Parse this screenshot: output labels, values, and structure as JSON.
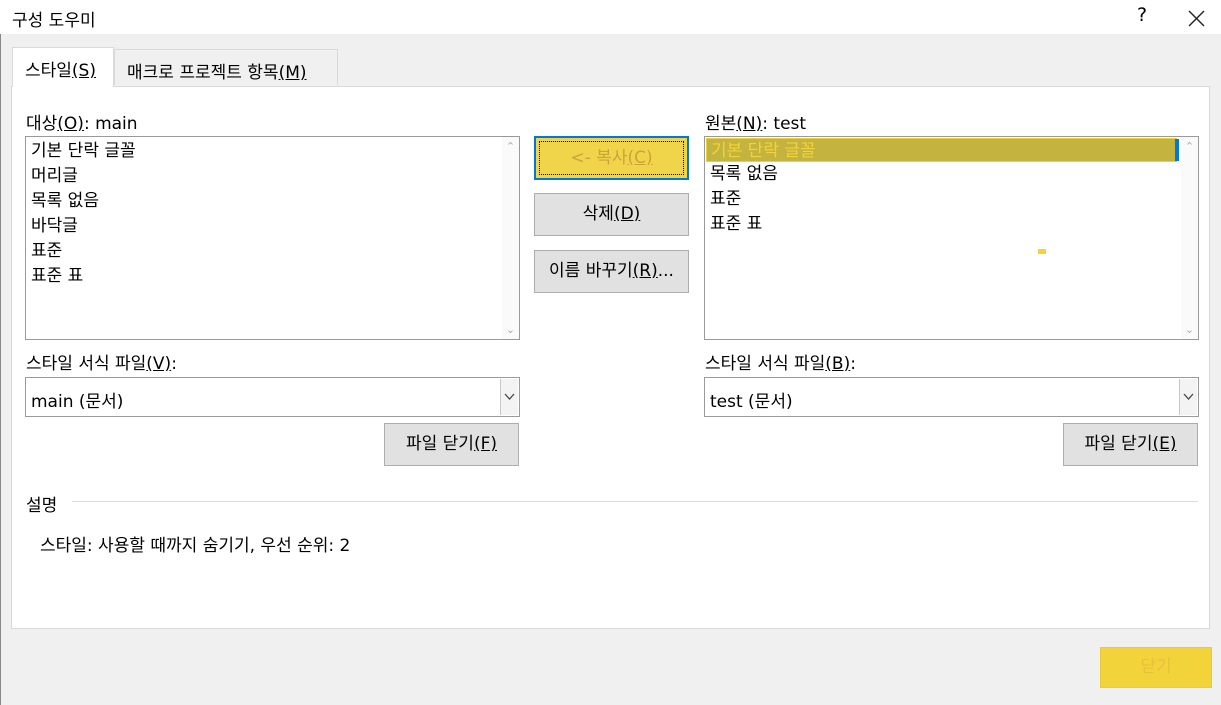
{
  "window": {
    "title": "구성 도우미",
    "help": "?"
  },
  "tabs": [
    {
      "text": "스타일",
      "mnemonic": "(S)",
      "active": true
    },
    {
      "text": "매크로 프로젝트 항목",
      "mnemonic": "(M)",
      "active": false
    }
  ],
  "left": {
    "label_pre": "대상",
    "label_mn": "(O)",
    "label_post": ": main",
    "items": [
      "기본 단락 글꼴",
      "머리글",
      "목록 없음",
      "바닥글",
      "표준",
      "표준 표"
    ],
    "stylesheet_label_pre": "스타일 서식 파일",
    "stylesheet_label_mn": "(V)",
    "stylesheet_label_post": ":",
    "stylesheet_value": "main (문서)",
    "close_file_pre": "파일 닫기",
    "close_file_mn": "(F)"
  },
  "right": {
    "label_pre": "원본",
    "label_mn": "(N)",
    "label_post": ": test",
    "items": [
      "기본 단락 글꼴",
      "목록 없음",
      "표준",
      "표준 표"
    ],
    "selected_index": 0,
    "stylesheet_label_pre": "스타일 서식 파일",
    "stylesheet_label_mn": "(B)",
    "stylesheet_label_post": ":",
    "stylesheet_value": "test (문서)",
    "close_file_pre": "파일 닫기",
    "close_file_mn": "(E)"
  },
  "buttons": {
    "copy_pre": "<- 복사",
    "copy_mn": "(C)",
    "delete_pre": "삭제",
    "delete_mn": "(D)",
    "rename_pre": "이름 바꾸기",
    "rename_mn": "(R)",
    "rename_post": "...",
    "close": "닫기"
  },
  "description": {
    "heading": "설명",
    "text": "스타일: 사용할 때까지 숨기기, 우선 순위: 2"
  },
  "colors": {
    "highlight": "#f3d33a",
    "selection_bg": "#c4b33f",
    "focus": "#0078d7"
  }
}
